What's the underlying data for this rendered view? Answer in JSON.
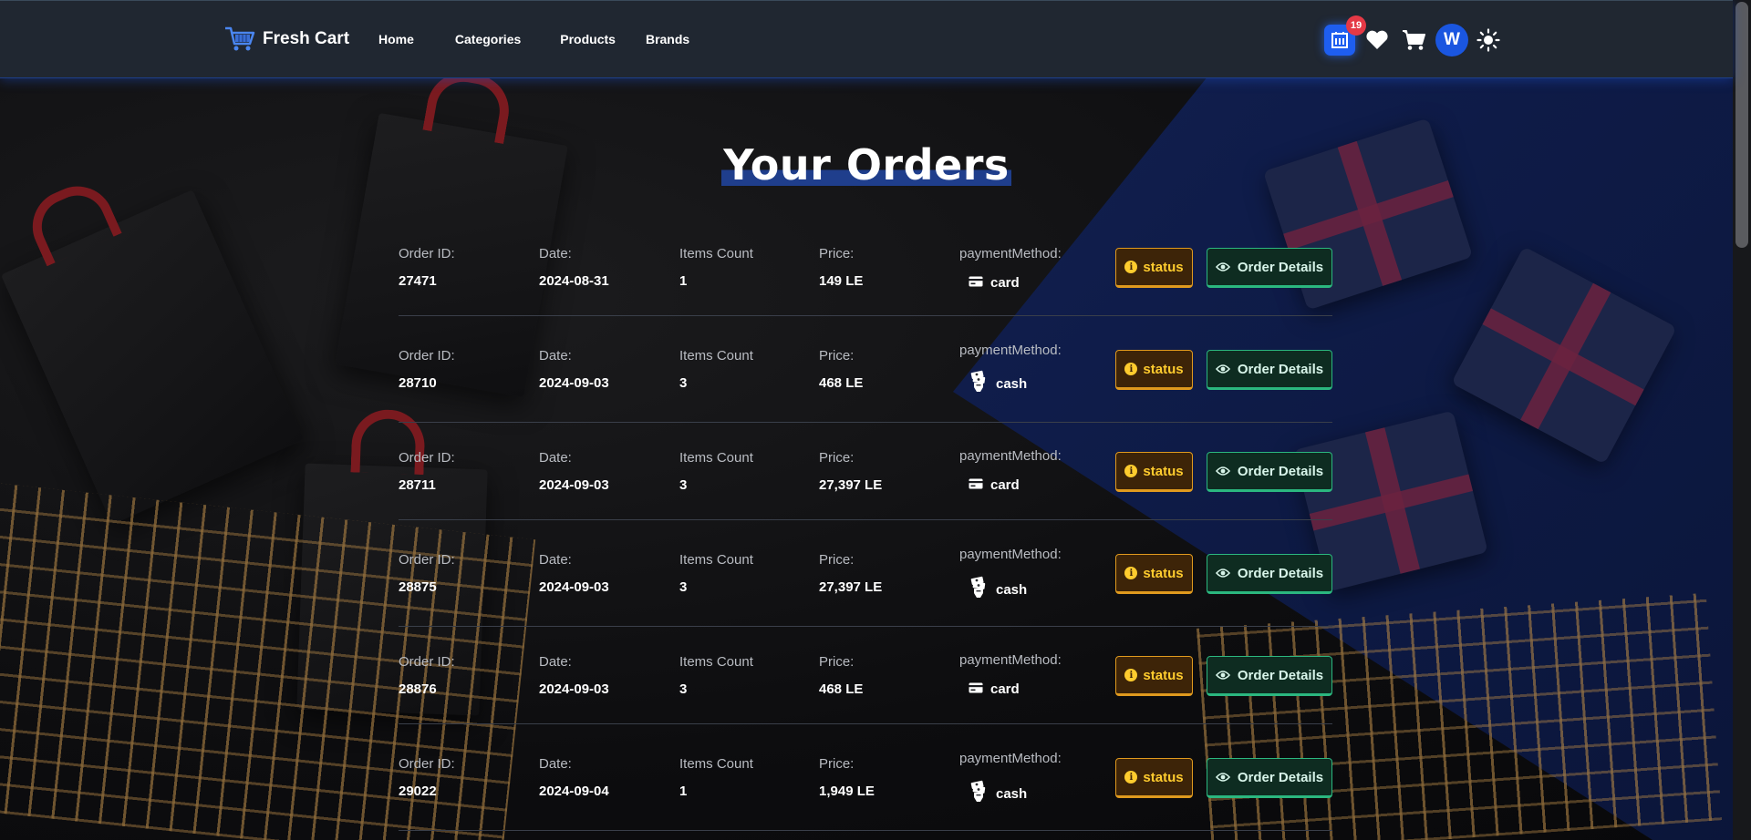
{
  "navbar": {
    "brand": "Fresh Cart",
    "links": [
      "Home",
      "Categories",
      "Products",
      "Brands"
    ],
    "orders_badge": "19",
    "avatar_initial": "W"
  },
  "page": {
    "title": "Your Orders"
  },
  "labels": {
    "order_id": "Order ID:",
    "date": "Date:",
    "items_count": "Items Count",
    "price": "Price:",
    "payment_method": "paymentMethod:",
    "status_button": "status",
    "details_button": "Order Details"
  },
  "orders": [
    {
      "id": "27471",
      "date": "2024-08-31",
      "items": "1",
      "price": "149 LE",
      "payment": "card",
      "payment_icon": "credit-card-icon"
    },
    {
      "id": "28710",
      "date": "2024-09-03",
      "items": "3",
      "price": "468 LE",
      "payment": "cash",
      "payment_icon": "cash-icon"
    },
    {
      "id": "28711",
      "date": "2024-09-03",
      "items": "3",
      "price": "27,397 LE",
      "payment": "card",
      "payment_icon": "credit-card-icon"
    },
    {
      "id": "28875",
      "date": "2024-09-03",
      "items": "3",
      "price": "27,397 LE",
      "payment": "cash",
      "payment_icon": "cash-icon"
    },
    {
      "id": "28876",
      "date": "2024-09-03",
      "items": "3",
      "price": "468 LE",
      "payment": "card",
      "payment_icon": "credit-card-icon"
    },
    {
      "id": "29022",
      "date": "2024-09-04",
      "items": "1",
      "price": "1,949 LE",
      "payment": "cash",
      "payment_icon": "cash-icon"
    }
  ],
  "colors": {
    "navbar_bg": "#202731",
    "accent_blue": "#1e5ef0",
    "badge_red": "#e53946",
    "status_amber": "#e09a1e",
    "details_green": "#2bb77f"
  }
}
